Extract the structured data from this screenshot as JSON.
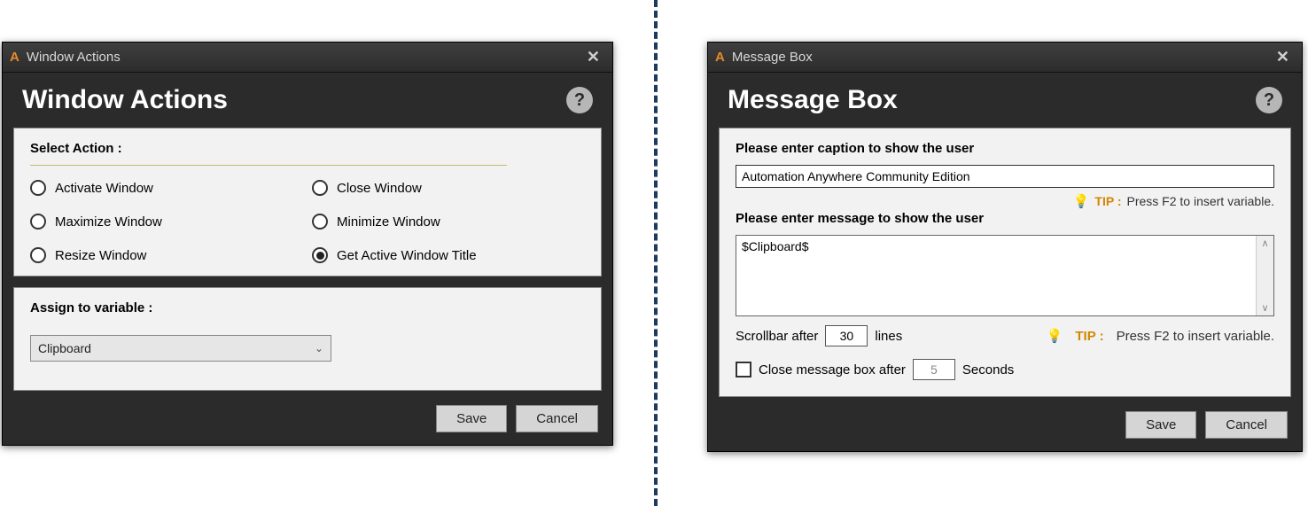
{
  "left": {
    "titlebar": "Window Actions",
    "heading": "Window Actions",
    "select_action_label": "Select Action :",
    "options": {
      "activate": "Activate Window",
      "close": "Close Window",
      "maximize": "Maximize Window",
      "minimize": "Minimize Window",
      "resize": "Resize Window",
      "get_title": "Get Active Window Title"
    },
    "assign_label": "Assign to variable :",
    "variable_value": "Clipboard",
    "save": "Save",
    "cancel": "Cancel"
  },
  "right": {
    "titlebar": "Message Box",
    "heading": "Message Box",
    "caption_label": "Please enter caption to show the user",
    "caption_value": "Automation Anywhere Community Edition",
    "tip_label": "TIP :",
    "tip_text": "Press F2 to insert variable.",
    "message_label": "Please enter message to show the user",
    "message_value": "$Clipboard$",
    "scrollbar_prefix": "Scrollbar after",
    "scrollbar_value": "30",
    "scrollbar_suffix": "lines",
    "close_after_label": "Close message box after",
    "close_after_value": "5",
    "close_after_suffix": "Seconds",
    "save": "Save",
    "cancel": "Cancel"
  }
}
